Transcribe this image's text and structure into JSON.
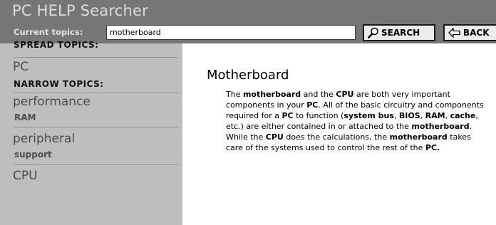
{
  "header": {
    "app_title": "PC HELP Searcher",
    "topics_label": "Current topics:",
    "search_value": "motherboard",
    "search_button_label": "SEARCH",
    "back_button_label": "BACK",
    "search_icon": "magnifier-icon",
    "back_icon": "left-arrow-icon"
  },
  "sidebar": {
    "spread_heading": "SPREAD TOPICS:",
    "spread_topics": [
      "PC"
    ],
    "narrow_heading": "NARROW TOPICS:",
    "narrow_topics": [
      {
        "label": "performance",
        "sub": "RAM"
      },
      {
        "label": "peripheral",
        "sub": "support"
      },
      {
        "label": "CPU",
        "sub": ""
      }
    ]
  },
  "article": {
    "title": "Motherboard",
    "body": [
      {
        "text": "The "
      },
      {
        "text": "motherboard",
        "bold": true
      },
      {
        "text": " and the "
      },
      {
        "text": "CPU",
        "bold": true
      },
      {
        "text": " are both very important components in your "
      },
      {
        "text": "PC",
        "bold": true
      },
      {
        "text": ". All of the basic circuitry and components required for a "
      },
      {
        "text": "PC",
        "bold": true
      },
      {
        "text": " to function ("
      },
      {
        "text": "system bus",
        "bold": true
      },
      {
        "text": ", "
      },
      {
        "text": "BIOS",
        "bold": true
      },
      {
        "text": ", "
      },
      {
        "text": "RAM",
        "bold": true
      },
      {
        "text": ", "
      },
      {
        "text": "cache",
        "bold": true
      },
      {
        "text": ", etc.) are either contained in or attached to the "
      },
      {
        "text": "motherboard",
        "bold": true
      },
      {
        "text": ".  While the "
      },
      {
        "text": "CPU",
        "bold": true
      },
      {
        "text": " does the calculations, the "
      },
      {
        "text": "motherboard",
        "bold": true
      },
      {
        "text": " takes care of the systems used to control the rest of the "
      },
      {
        "text": "PC.",
        "bold": true
      }
    ]
  },
  "colors": {
    "header_bg": "#767676",
    "sidebar_bg": "#bebebe",
    "sidebar_link": "#4c4c4c",
    "title_text": "#dcdcdc"
  }
}
